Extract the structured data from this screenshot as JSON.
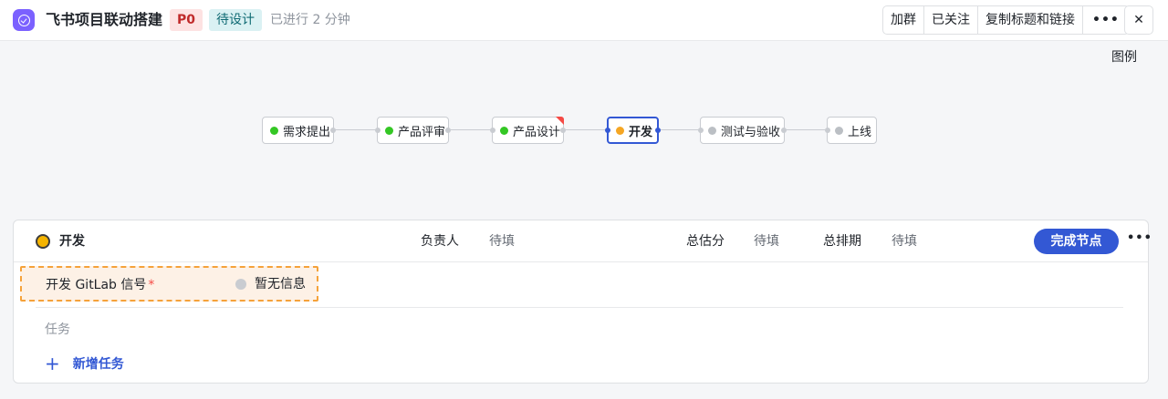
{
  "header": {
    "title": "飞书项目联动搭建",
    "priority": "P0",
    "status": "待设计",
    "elapsed": "已进行 2 分钟",
    "actions": [
      "加群",
      "已关注",
      "复制标题和链接"
    ],
    "more": "•••",
    "close": "✕"
  },
  "legend": "图例",
  "flow": {
    "nodes": [
      {
        "label": "需求提出",
        "status": "done",
        "color": "#34c724"
      },
      {
        "label": "产品评审",
        "status": "done",
        "color": "#34c724"
      },
      {
        "label": "产品设计",
        "status": "done",
        "color": "#34c724"
      },
      {
        "label": "开发",
        "status": "active",
        "color": "#f5a623"
      },
      {
        "label": "测试与验收",
        "status": "pending",
        "color": "#bbbfc4"
      },
      {
        "label": "上线",
        "status": "pending",
        "color": "#bbbfc4"
      }
    ]
  },
  "panel": {
    "stage_name": "开发",
    "owner_label": "负责人",
    "owner_value": "待填",
    "estimate_label": "总估分",
    "estimate_value": "待填",
    "schedule_label": "总排期",
    "schedule_value": "待填",
    "complete_button": "完成节点",
    "more": "•••",
    "signal_label": "开发 GitLab 信号",
    "signal_required": "*",
    "signal_value": "暂无信息",
    "tasks_label": "任务",
    "add_task_icon": "+",
    "add_task_label": "新增任务"
  },
  "colors": {
    "accent": "#3358d4",
    "priority_bg": "#fde2e2",
    "status_bg": "#daf1f3",
    "active_stage": "#f5b400"
  }
}
